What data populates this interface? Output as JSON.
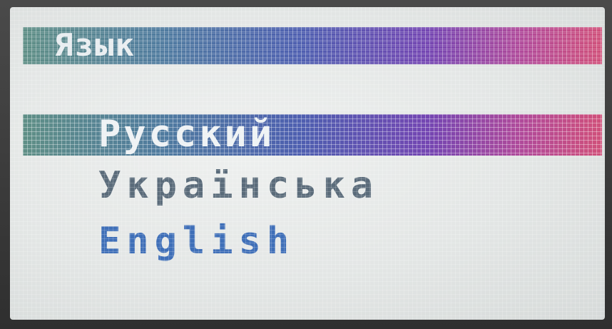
{
  "screen": {
    "title": "Язык"
  },
  "menu": {
    "items": [
      {
        "label": "Русский",
        "selected": true
      },
      {
        "label": "Українська",
        "selected": false
      },
      {
        "label": "English",
        "selected": false
      }
    ]
  },
  "colors": {
    "bar_gradient_start": "#5f8f86",
    "bar_gradient_mid": "#4e5fb0",
    "bar_gradient_end": "#d0507a",
    "screen_background": "#e6e8e8",
    "unselected_text": "#5a6b7a",
    "english_text": "#3f6fb8",
    "selected_text": "#eef2f4"
  }
}
